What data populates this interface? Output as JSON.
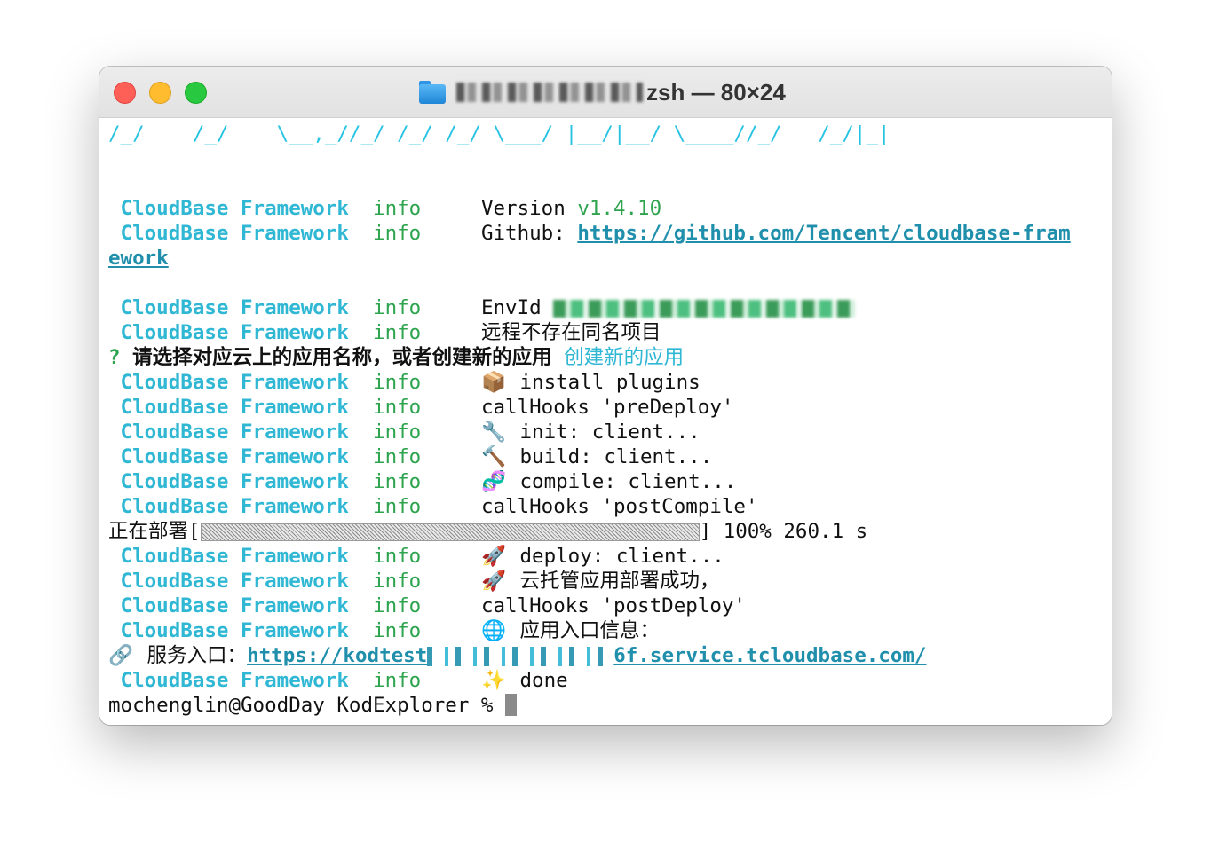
{
  "window": {
    "title_suffix": "zsh — 80×24"
  },
  "icons": {
    "folder": "folder-icon",
    "package": "📦",
    "wrench": "🔧",
    "hammer": "🔨",
    "dna": "🧬",
    "rocket": "🚀",
    "globe": "🌐",
    "link": "🔗",
    "sparkles": "✨"
  },
  "colors": {
    "tag": "#2fb7d4",
    "level": "#2ea44f",
    "link": "#1f8fab",
    "close": "#fe5f57",
    "minimize": "#febc2e",
    "maximize": "#28c840"
  },
  "terminal": {
    "banner": "/_/    /_/    \\__,_//_/ /_/ /_/ \\___/ |__/|__/ \\____//_/   /_/|_|",
    "tag": "CloudBase Framework",
    "level": "info",
    "version_label": "Version",
    "version_value": "v1.4.10",
    "github_label": "Github:",
    "github_url_part1": "https://github.com/Tencent/cloudbase-fram",
    "github_url_part2": "ework",
    "envid_label": "EnvId",
    "remote_msg": "远程不存在同名项目",
    "question_mark": "?",
    "question_text": "请选择对应云上的应用名称，或者创建新的应用",
    "question_answer": "创建新的应用",
    "install_msg": "install plugins",
    "prehook_msg": "callHooks 'preDeploy'",
    "init_msg": "init: client...",
    "build_msg": "build: client...",
    "compile_msg": "compile: client...",
    "postcompile_msg": "callHooks 'postCompile'",
    "deploy_label": "正在部署",
    "deploy_open": "[",
    "deploy_close": "]",
    "deploy_percent": "100%",
    "deploy_time": "260.1 s",
    "deploy_client_msg": "deploy: client...",
    "deploy_success_msg": "云托管应用部署成功，",
    "postdeploy_msg": "callHooks 'postDeploy'",
    "entry_info_msg": "应用入口信息：",
    "service_label": "服务入口：",
    "service_url_start": "https://kodtest",
    "service_url_end": "6f.service.tcloudbase.com/",
    "done_msg": "done",
    "prompt": "mochenglin@GoodDay KodExplorer % "
  }
}
